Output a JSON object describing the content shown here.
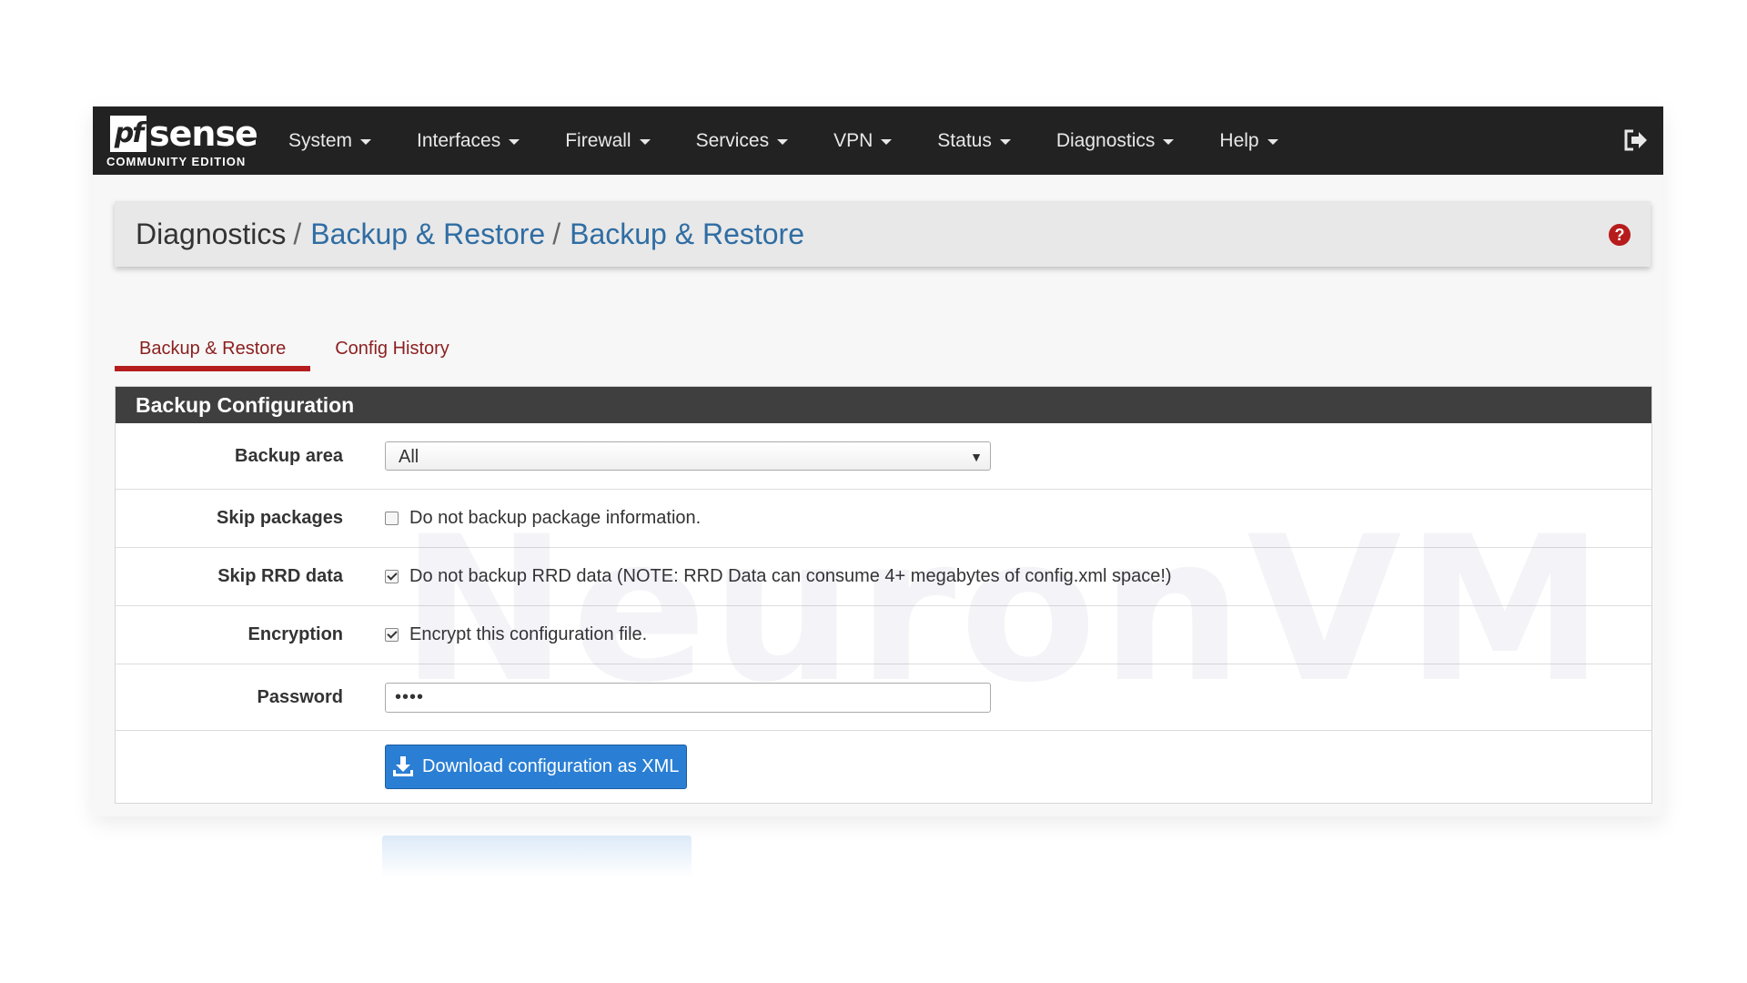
{
  "navbar": {
    "logo": {
      "brand": "pfsense",
      "edition": "COMMUNITY EDITION"
    },
    "menu": [
      {
        "label": "System"
      },
      {
        "label": "Interfaces"
      },
      {
        "label": "Firewall"
      },
      {
        "label": "Services"
      },
      {
        "label": "VPN"
      },
      {
        "label": "Status"
      },
      {
        "label": "Diagnostics"
      },
      {
        "label": "Help"
      }
    ],
    "logout_icon": "sign-out-icon"
  },
  "breadcrumb": {
    "root": "Diagnostics",
    "separator": "/",
    "items": [
      "Backup & Restore",
      "Backup & Restore"
    ],
    "help_icon": "question-circle-icon",
    "help_symbol": "?"
  },
  "tabs": [
    {
      "label": "Backup & Restore",
      "active": true
    },
    {
      "label": "Config History",
      "active": false
    }
  ],
  "panel": {
    "heading": "Backup Configuration",
    "backup_area": {
      "label": "Backup area",
      "value": "All"
    },
    "skip_packages": {
      "label": "Skip packages",
      "text": "Do not backup package information.",
      "checked": false
    },
    "skip_rrd": {
      "label": "Skip RRD data",
      "text": "Do not backup RRD data (NOTE: RRD Data can consume 4+ megabytes of config.xml space!)",
      "checked": true
    },
    "encryption": {
      "label": "Encryption",
      "text": "Encrypt this configuration file.",
      "checked": true
    },
    "password": {
      "label": "Password",
      "value": "••••"
    },
    "download_button": {
      "label": "Download configuration as XML",
      "icon": "download-icon"
    }
  },
  "watermark": "NeuronVM",
  "colors": {
    "navbar_bg": "#222222",
    "link_blue": "#2f6da3",
    "tab_red": "#b51e1e",
    "primary_button": "#2a7fd4",
    "panel_heading_bg": "#3f3f3f"
  }
}
